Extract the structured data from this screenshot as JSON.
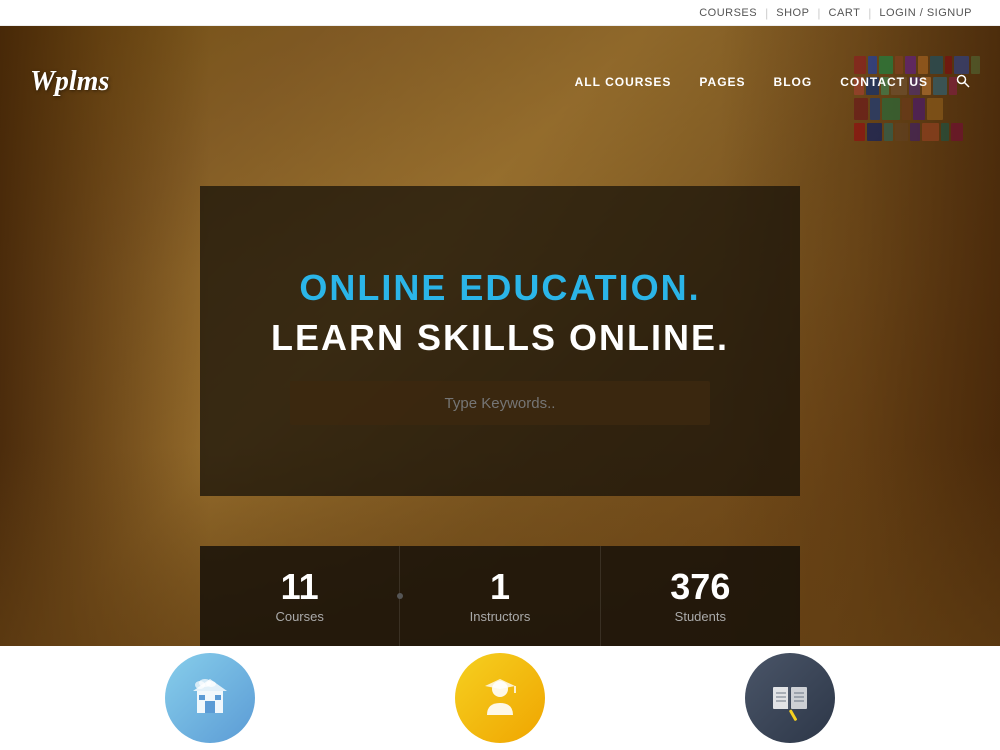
{
  "topbar": {
    "links": [
      {
        "label": "COURSES",
        "id": "courses"
      },
      {
        "label": "SHOP",
        "id": "shop"
      },
      {
        "label": "CART",
        "id": "cart"
      },
      {
        "label": "LOGIN / SIGNUP",
        "id": "login"
      }
    ]
  },
  "nav": {
    "logo": "Wplms",
    "links": [
      {
        "label": "ALL COURSES",
        "id": "all-courses"
      },
      {
        "label": "PAGES",
        "id": "pages"
      },
      {
        "label": "BLOG",
        "id": "blog"
      },
      {
        "label": "CONTACT US",
        "id": "contact"
      }
    ],
    "search_icon": "🔍"
  },
  "hero": {
    "subtitle": "ONLINE EDUCATION.",
    "title": "LEARN SKILLS ONLINE.",
    "search_placeholder": "Type Keywords..",
    "stats": [
      {
        "number": "11",
        "label": "Courses"
      },
      {
        "number": "1",
        "label": "Instructors"
      },
      {
        "number": "376",
        "label": "Students"
      }
    ]
  },
  "bottom_icons": [
    {
      "color": "blue",
      "type": "building"
    },
    {
      "color": "yellow",
      "type": "person"
    },
    {
      "color": "dark",
      "type": "book"
    }
  ],
  "colors": {
    "accent_blue": "#2BB5E8",
    "hero_text_white": "#ffffff",
    "hero_bg_dark": "rgba(20,15,8,0.82)",
    "stat_number": "#ffffff",
    "stat_label": "#aaaaaa"
  }
}
